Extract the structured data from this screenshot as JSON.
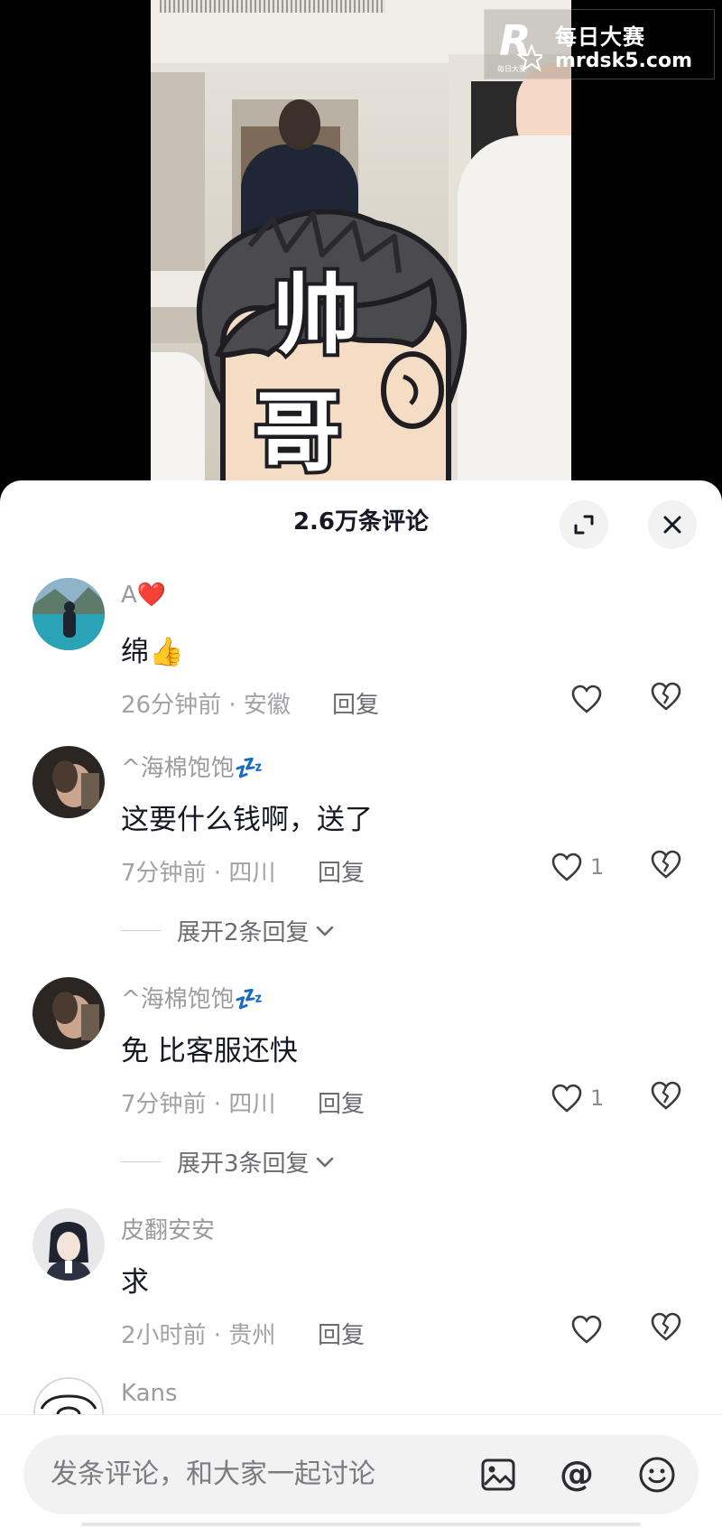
{
  "watermark": {
    "logo_letter": "R",
    "logo_caption": "每日大赛",
    "title": "每日大赛",
    "url": "mrdsk5.com"
  },
  "sticker": {
    "line1": "帅",
    "line2": "哥"
  },
  "sheet": {
    "title": "2.6万条评论",
    "expand_icon": "expand-arrows-icon",
    "close_icon": "close-icon"
  },
  "comments": [
    {
      "name": "A❤️",
      "text": "绵👍",
      "time": "26分钟前 · 安徽",
      "reply": "回复",
      "likes": "",
      "avatar": "lake-scenery"
    },
    {
      "name": "^海棉饱饱💤",
      "text": "这要什么钱啊，送了",
      "time": "7分钟前 · 四川",
      "reply": "回复",
      "likes": "1",
      "expand": "展开2条回复",
      "avatar": "dark-photo"
    },
    {
      "name": "^海棉饱饱💤",
      "text": "免 比客服还快",
      "time": "7分钟前 · 四川",
      "reply": "回复",
      "likes": "1",
      "expand": "展开3条回复",
      "avatar": "dark-photo"
    },
    {
      "name": "皮翻安安",
      "text": "求",
      "time": "2小时前 · 贵州",
      "reply": "回复",
      "likes": "",
      "avatar": "anime-portrait"
    },
    {
      "name": "Kans",
      "avatar": "cartoon-pig"
    }
  ],
  "input": {
    "placeholder": "发条评论，和大家一起讨论",
    "icons": [
      "image-icon",
      "at-icon",
      "emoji-icon"
    ]
  },
  "colors": {
    "text_primary": "#161823",
    "text_secondary": "#9a9a9f",
    "sheet_bg": "#ffffff",
    "pill_bg": "#f2f2f3"
  }
}
